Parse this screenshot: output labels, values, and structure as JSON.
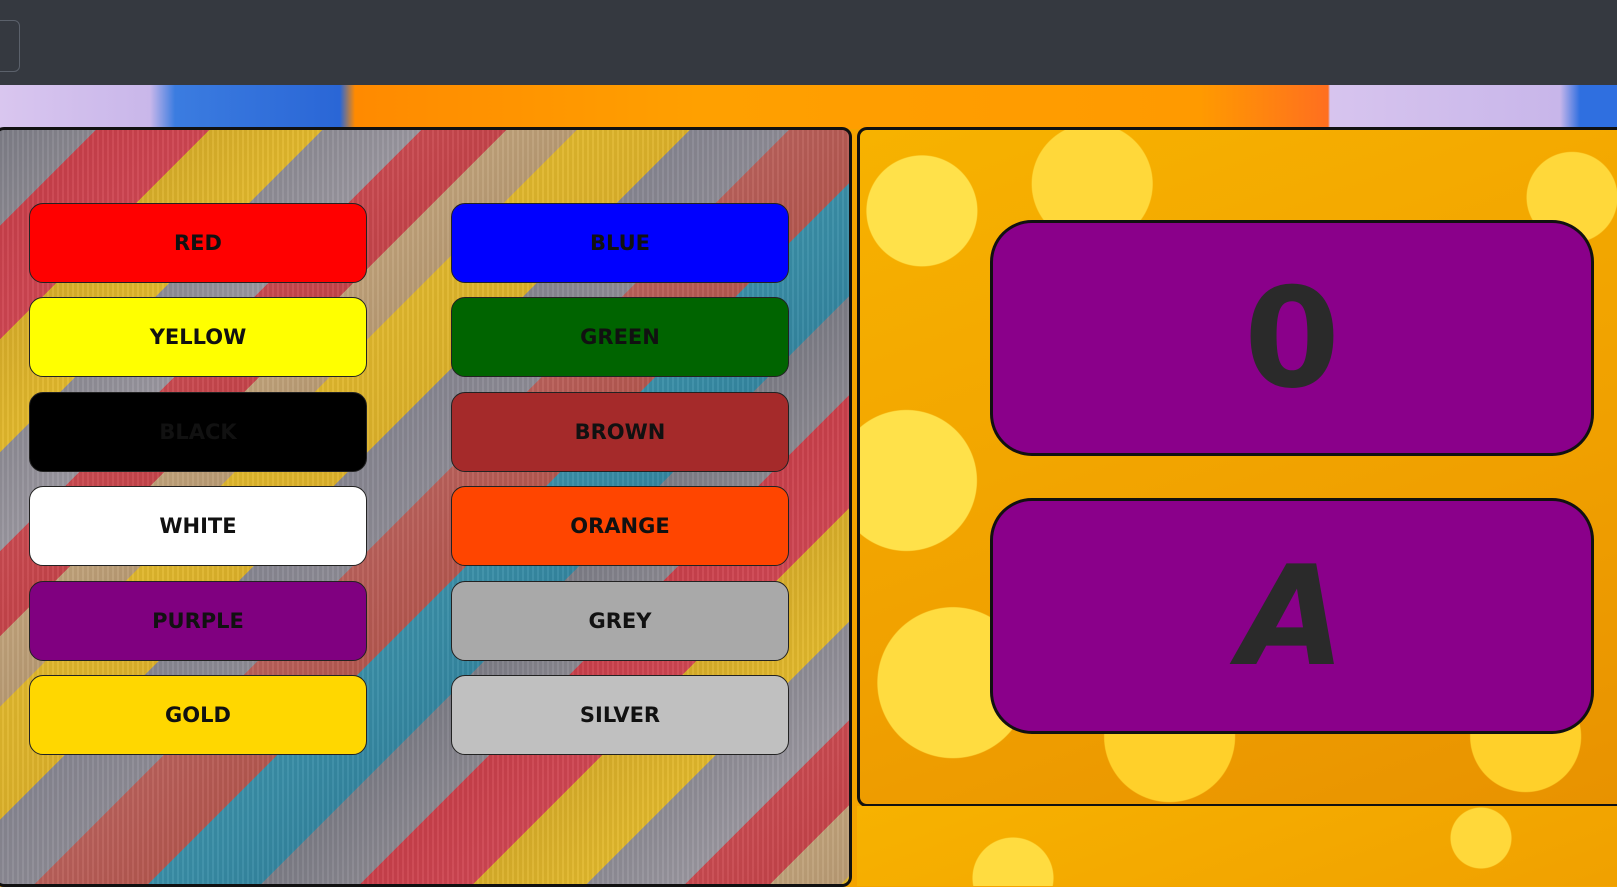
{
  "colors": {
    "topbar": "#353940",
    "card": "#8a008a"
  },
  "buttons": [
    {
      "label": "RED",
      "bg": "#ff0000"
    },
    {
      "label": "BLUE",
      "bg": "#0000ff"
    },
    {
      "label": "YELLOW",
      "bg": "#ffff00"
    },
    {
      "label": "GREEN",
      "bg": "#006400"
    },
    {
      "label": "BLACK",
      "bg": "#000000"
    },
    {
      "label": "BROWN",
      "bg": "#a52a2a"
    },
    {
      "label": "WHITE",
      "bg": "#ffffff"
    },
    {
      "label": "ORANGE",
      "bg": "#ff4500"
    },
    {
      "label": "PURPLE",
      "bg": "#800080"
    },
    {
      "label": "GREY",
      "bg": "#a9a9a9"
    },
    {
      "label": "GOLD",
      "bg": "#ffd700"
    },
    {
      "label": "SILVER",
      "bg": "#c0c0c0"
    }
  ],
  "display": {
    "top_value": "0",
    "bottom_value": "A"
  }
}
